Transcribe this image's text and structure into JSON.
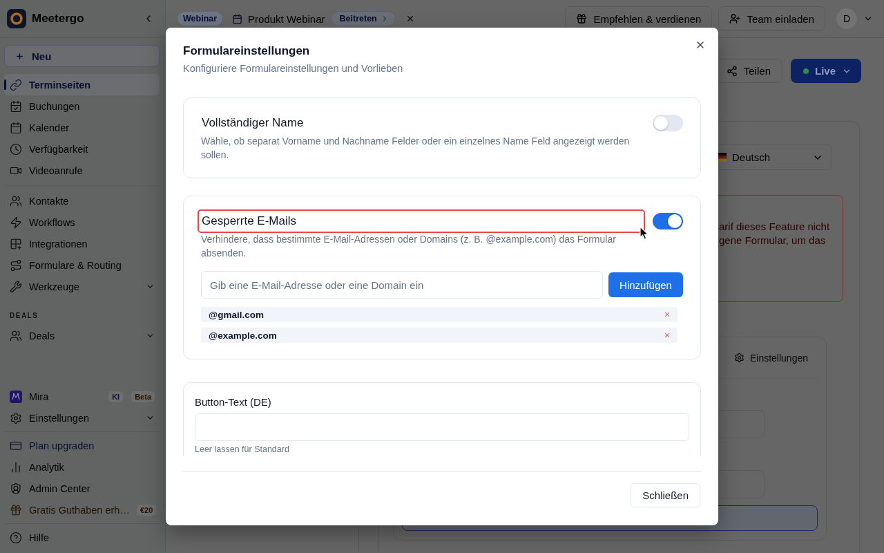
{
  "sidebar": {
    "brand": "Meetergo",
    "new_button": "Neu",
    "groups": [
      {
        "items": [
          {
            "label": "Terminseiten",
            "kind": "link",
            "selected": true
          },
          {
            "label": "Buchungen",
            "kind": "link",
            "selected": false
          },
          {
            "label": "Kalender",
            "kind": "link",
            "selected": false
          },
          {
            "label": "Verfügbarkeit",
            "kind": "link",
            "selected": false
          },
          {
            "label": "Videoanrufe",
            "kind": "link",
            "selected": false
          }
        ]
      },
      {
        "items": [
          {
            "label": "Kontakte",
            "kind": "link",
            "selected": false
          },
          {
            "label": "Workflows",
            "kind": "link",
            "selected": false
          },
          {
            "label": "Integrationen",
            "kind": "link",
            "selected": false
          },
          {
            "label": "Formulare & Routing",
            "kind": "link",
            "selected": false
          },
          {
            "label": "Werkzeuge",
            "kind": "menu",
            "selected": false
          }
        ]
      },
      {
        "heading": "DEALS",
        "items": [
          {
            "label": "Deals",
            "kind": "menu",
            "selected": false
          }
        ]
      }
    ],
    "footer_groups": [
      {
        "items": [
          {
            "label": "Mira",
            "kind": "link",
            "selected": false,
            "badges": [
              {
                "text": "KI",
                "color": "#1c0b44"
              },
              {
                "text": "Beta",
                "color": "#2a1502"
              }
            ]
          },
          {
            "label": "Einstellungen",
            "kind": "menu",
            "selected": false
          }
        ]
      },
      {
        "items": [
          {
            "label": "Plan upgraden",
            "kind": "upgrade",
            "selected": false
          },
          {
            "label": "Analytik",
            "kind": "link",
            "selected": false
          },
          {
            "label": "Admin Center",
            "kind": "link",
            "selected": false
          },
          {
            "label": "Gratis Guthaben erh…",
            "kind": "promo",
            "selected": false,
            "badges": [
              {
                "text": "€20",
                "color": "#2a1502"
              }
            ]
          }
        ]
      },
      {
        "items": [
          {
            "label": "Hilfe",
            "kind": "link",
            "selected": false
          }
        ]
      }
    ]
  },
  "topbar": {
    "event_type": "Webinar",
    "event_title": "Produkt Webinar",
    "join_button": "Beitreten",
    "actions": [
      {
        "label": "Empfehlen & verdienen"
      },
      {
        "label": "Team einladen"
      }
    ],
    "avatar": "D"
  },
  "page": {
    "share_button": "Teilen",
    "status_button": "Live",
    "language": "Deutsch",
    "alert_lines": [
      "arif dieses Feature nicht",
      "gene Formular, um das"
    ],
    "settings_tab": "Einstellungen"
  },
  "modal": {
    "title": "Formulareinstellungen",
    "subtitle": "Konfiguriere Formulareinstellungen und Vorlieben",
    "cards": [
      {
        "kind": "toggle",
        "title": "Vollständiger Name",
        "description": "Wähle, ob separat Vorname und Nachname Felder oder ein einzelnes Name Feld angezeigt werden sollen.",
        "on": false,
        "highlighted": false
      },
      {
        "kind": "toggle",
        "title": "Gesperrte E-Mails",
        "description": "Verhindere, dass bestimmte E-Mail-Adressen oder Domains (z. B. @example.com) das Formular absenden.",
        "on": true,
        "highlighted": true,
        "input": {
          "placeholder": "Gib eine E-Mail-Adresse oder eine Domain ein"
        },
        "add_button": "Hinzufügen",
        "entries": [
          "@gmail.com",
          "@example.com"
        ]
      },
      {
        "kind": "text_field",
        "label": "Button-Text (DE)",
        "helper_text": "Leer lassen für Standard"
      }
    ],
    "close_button": "Schließen"
  }
}
